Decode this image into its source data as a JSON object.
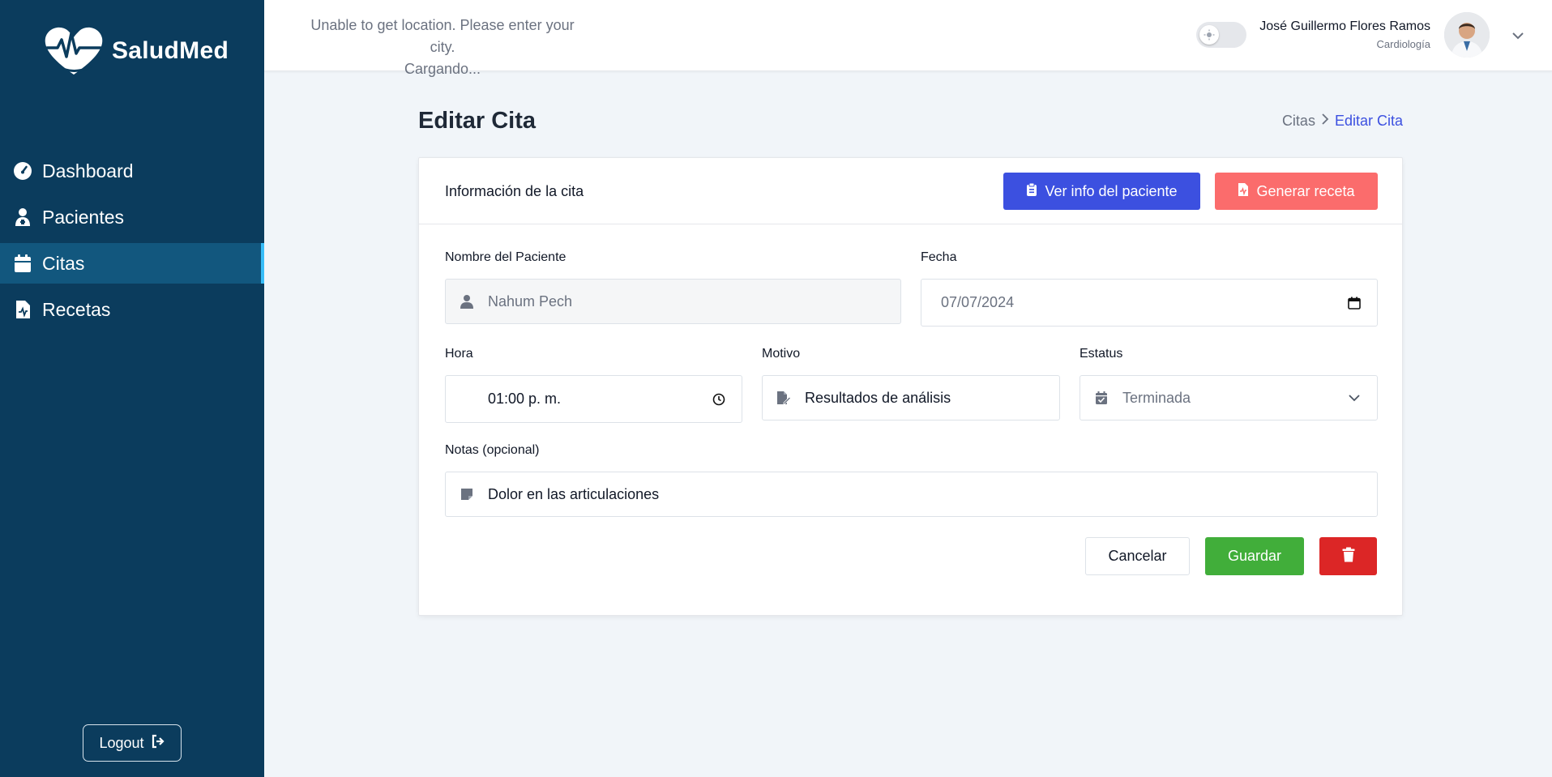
{
  "app": {
    "brand": "SaludMed"
  },
  "sidebar": {
    "items": [
      {
        "label": "Dashboard",
        "icon": "gauge-icon",
        "active": false
      },
      {
        "label": "Pacientes",
        "icon": "patient-icon",
        "active": false
      },
      {
        "label": "Citas",
        "icon": "calendar-icon",
        "active": true
      },
      {
        "label": "Recetas",
        "icon": "prescription-icon",
        "active": false
      }
    ],
    "logout_label": "Logout"
  },
  "header": {
    "location_line1": "Unable to get location. Please enter your city.",
    "location_line2": "Cargando...",
    "user_name": "José Guillermo Flores Ramos",
    "user_role": "Cardiología"
  },
  "page": {
    "title": "Editar Cita",
    "breadcrumb": {
      "parent": "Citas",
      "current": "Editar Cita"
    }
  },
  "card": {
    "title": "Información de la cita",
    "view_patient_label": "Ver info del paciente",
    "generate_prescription_label": "Generar receta"
  },
  "form": {
    "patient_label": "Nombre del Paciente",
    "patient_value": "Nahum Pech",
    "date_label": "Fecha",
    "date_value": "07/07/2024",
    "time_label": "Hora",
    "time_value": "01:00 p. m.",
    "reason_label": "Motivo",
    "reason_value": "Resultados de análisis",
    "status_label": "Estatus",
    "status_value": "Terminada",
    "notes_label": "Notas (opcional)",
    "notes_value": "Dolor en las articulaciones"
  },
  "actions": {
    "cancel_label": "Cancelar",
    "save_label": "Guardar"
  },
  "colors": {
    "sidebar_bg": "#0b3c5d",
    "sidebar_active": "#12577e",
    "primary": "#3c50e0",
    "danger_light": "#fb6c6c",
    "success": "#41ae3a",
    "danger": "#dc2626"
  }
}
